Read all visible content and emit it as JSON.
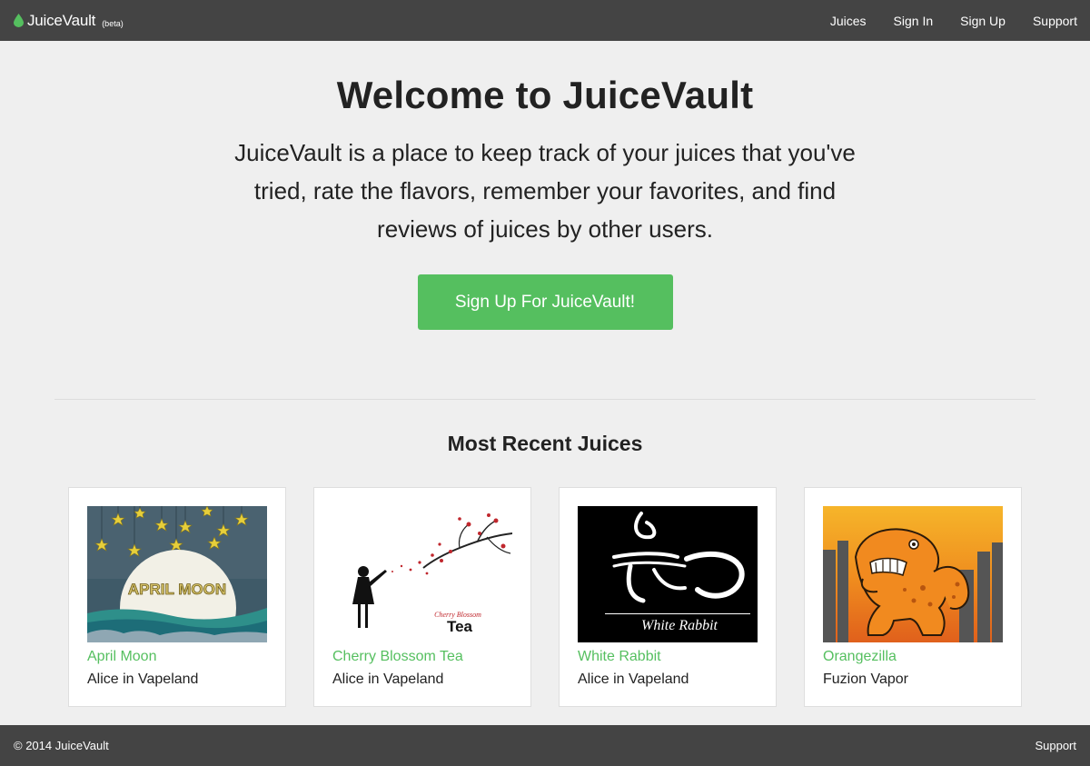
{
  "navbar": {
    "brand_name": "JuiceVault",
    "brand_badge": "(beta)",
    "brand_icon": "droplet-icon",
    "links": [
      "Juices",
      "Sign In",
      "Sign Up",
      "Support"
    ]
  },
  "hero": {
    "title": "Welcome to JuiceVault",
    "description": "JuiceVault is a place to keep track of your juices that you've tried, rate the flavors, remember your favorites, and find reviews of juices by other users.",
    "cta_label": "Sign Up For JuiceVault!"
  },
  "recent": {
    "title": "Most Recent Juices",
    "items": [
      {
        "name": "April Moon",
        "brand": "Alice in Vapeland",
        "image_text": "APRIL MOON"
      },
      {
        "name": "Cherry Blossom Tea",
        "brand": "Alice in Vapeland",
        "image_text": "Cherry Blossom",
        "image_text_2": "Tea"
      },
      {
        "name": "White Rabbit",
        "brand": "Alice in Vapeland",
        "image_text": "White Rabbit"
      },
      {
        "name": "Orangezilla",
        "brand": "Fuzion Vapor"
      }
    ]
  },
  "footer": {
    "copyright": "© 2014 JuiceVault",
    "support": "Support"
  },
  "colors": {
    "navbar_bg": "#444444",
    "accent_green": "#55bf5f",
    "page_bg": "#efefef"
  }
}
